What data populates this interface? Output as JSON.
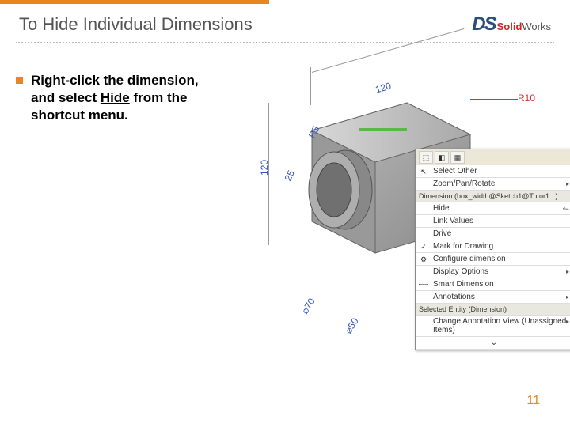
{
  "slide": {
    "title": "To Hide Individual Dimensions",
    "page_number": "11"
  },
  "logo": {
    "ds": "DS",
    "solid": "Solid",
    "works": "Works"
  },
  "bullet": {
    "prefix": "Right-click the dimension, and select ",
    "hide": "Hide",
    "suffix": " from the shortcut menu."
  },
  "dimensions": {
    "d120_v": "120",
    "d120_h": "120",
    "d25": "25",
    "r5": "R5",
    "r10": "R10",
    "dia70": "⌀70",
    "dia50": "⌀50"
  },
  "menu": {
    "select_other": "Select Other",
    "zoom": "Zoom/Pan/Rotate",
    "dim_header": "Dimension (box_width@Sketch1@Tutor1...)",
    "hide": "Hide",
    "link_values": "Link Values",
    "drive": "Drive",
    "mark": "Mark for Drawing",
    "configure": "Configure dimension",
    "display": "Display Options",
    "smart": "Smart Dimension",
    "annotations": "Annotations",
    "sel_entity": "Selected Entity (Dimension)",
    "change_annot": "Change Annotation View (Unassigned Items)",
    "collapse": "⌄"
  }
}
